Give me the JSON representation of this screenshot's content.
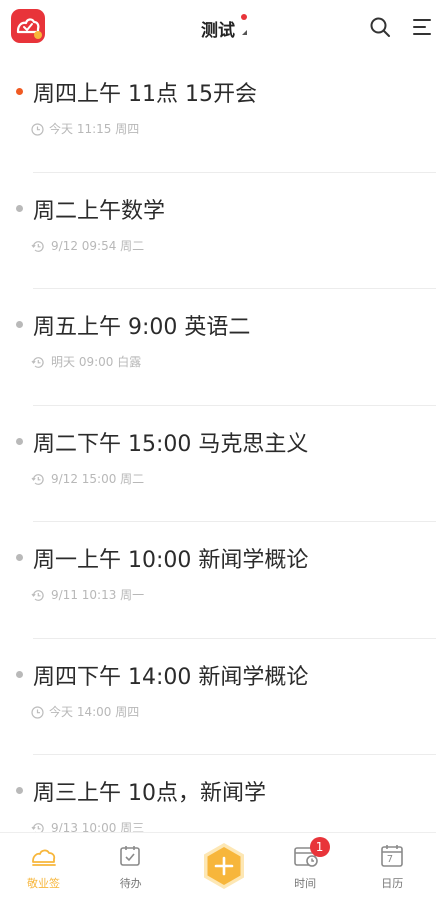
{
  "header": {
    "title": "测试"
  },
  "items": [
    {
      "title": "周四上午 11点 15开会",
      "meta": "今天 11:15 周四",
      "icon": "clock-icon",
      "active": true
    },
    {
      "title": "周二上午数学",
      "meta": "9/12 09:54 周二",
      "icon": "repeat-clock-icon",
      "active": false
    },
    {
      "title": "周五上午 9:00  英语二",
      "meta": "明天 09:00 白露",
      "icon": "repeat-clock-icon",
      "active": false
    },
    {
      "title": "周二下午 15:00 马克思主义",
      "meta": "9/12 15:00 周二",
      "icon": "repeat-clock-icon",
      "active": false
    },
    {
      "title": "周一上午 10:00  新闻学概论",
      "meta": "9/11 10:13 周一",
      "icon": "repeat-clock-icon",
      "active": false
    },
    {
      "title": "周四下午 14:00  新闻学概论",
      "meta": "今天 14:00 周四",
      "icon": "clock-icon",
      "active": false
    },
    {
      "title": "周三上午 10点，新闻学",
      "meta": "9/13 10:00 周三",
      "icon": "repeat-clock-icon",
      "active": false
    }
  ],
  "tabs": [
    {
      "label": "敬业签",
      "icon": "cloud-note-icon",
      "active": true
    },
    {
      "label": "待办",
      "icon": "checklist-icon",
      "active": false
    },
    {
      "label": "",
      "icon": "add-icon",
      "active": false
    },
    {
      "label": "时间",
      "icon": "calendar-clock-icon",
      "active": false,
      "badge": "1"
    },
    {
      "label": "日历",
      "icon": "calendar-day-icon",
      "active": false,
      "day": "7"
    }
  ],
  "colors": {
    "accent": "#f7b63b",
    "brand": "#e8343a",
    "active_dot": "#f05a22",
    "meta": "#b8b8b8"
  }
}
